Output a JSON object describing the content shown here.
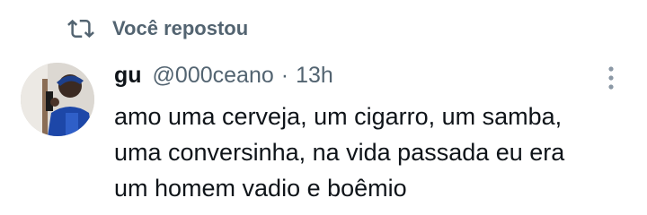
{
  "repost": {
    "label": "Você repostou",
    "icon": "repost-icon"
  },
  "tweet": {
    "author_name": "gu",
    "handle": "@000ceano",
    "separator": "·",
    "time": "13h",
    "text_lines": [
      "amo uma cerveja, um cigarro, um samba,",
      "uma conversinha, na vida passada eu era",
      "um homem vadio e boêmio"
    ]
  },
  "colors": {
    "primary_text": "#0f1419",
    "secondary_text": "#536471",
    "background": "#ffffff"
  },
  "icons": {
    "more": "more-vertical-icon",
    "avatar": "avatar"
  }
}
